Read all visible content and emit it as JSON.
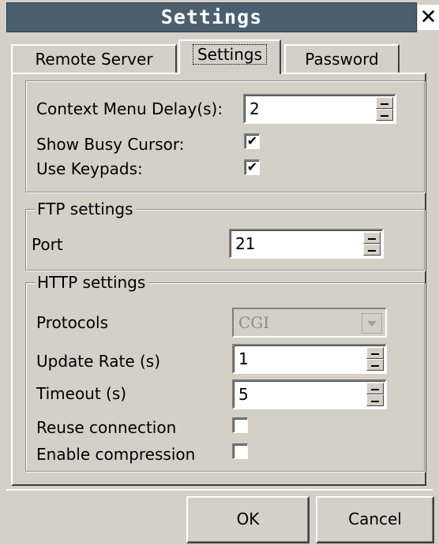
{
  "window": {
    "title": "Settings",
    "close_glyph": "✕"
  },
  "tabs": [
    {
      "label": "Remote Server"
    },
    {
      "label": "Settings"
    },
    {
      "label": "Password"
    }
  ],
  "general": {
    "context_menu_delay_label": "Context Menu Delay(s):",
    "context_menu_delay_value": "2",
    "show_busy_cursor_label": "Show Busy Cursor:",
    "show_busy_cursor_checked": true,
    "use_keypads_label": "Use Keypads:",
    "use_keypads_checked": true
  },
  "ftp": {
    "legend": "FTP settings",
    "port_label": "Port",
    "port_value": "21"
  },
  "http": {
    "legend": "HTTP settings",
    "protocols_label": "Protocols",
    "protocols_value": "CGI",
    "update_rate_label": "Update Rate (s)",
    "update_rate_value": "1",
    "timeout_label": "Timeout (s)",
    "timeout_value": "5",
    "reuse_connection_label": "Reuse connection",
    "reuse_connection_checked": false,
    "enable_compression_label": "Enable compression",
    "enable_compression_checked": false
  },
  "buttons": {
    "ok": "OK",
    "cancel": "Cancel"
  },
  "icons": {
    "check": "✔"
  }
}
